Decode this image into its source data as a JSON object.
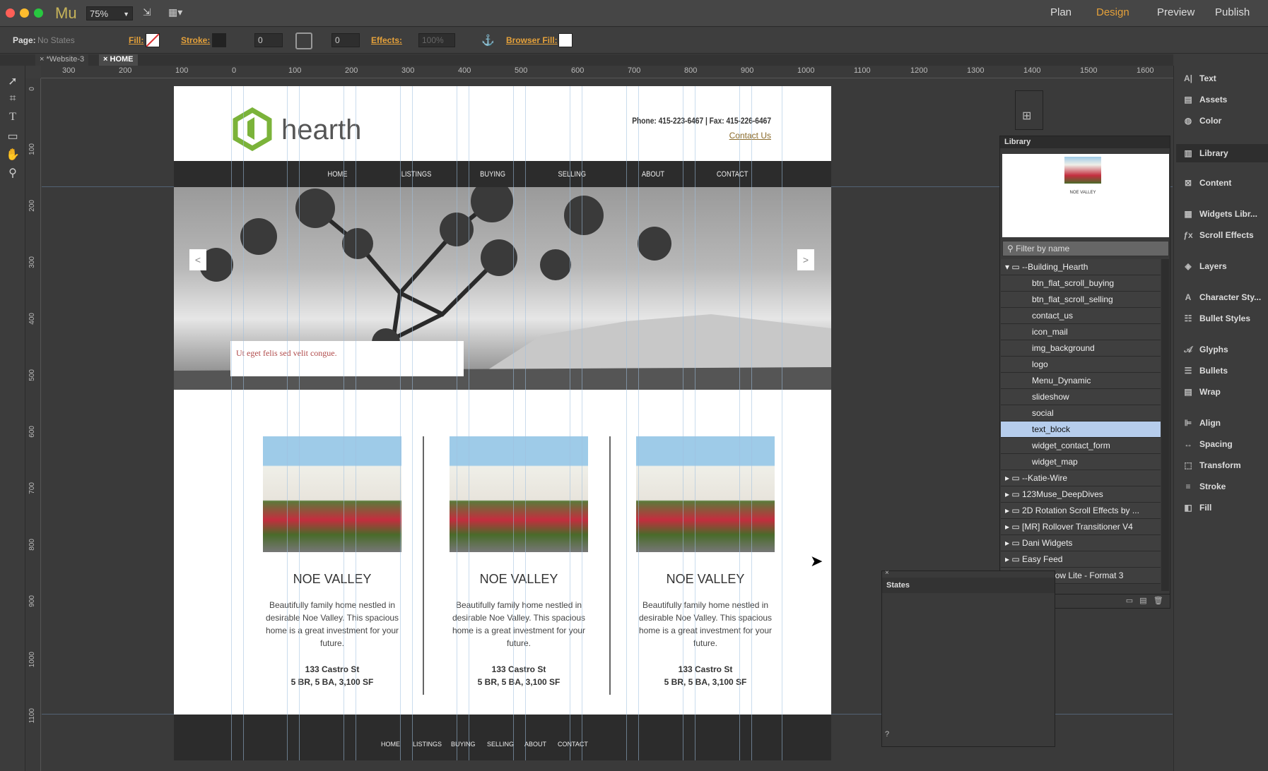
{
  "app": {
    "name": "Mu",
    "zoom": "75%",
    "modes": [
      "Plan",
      "Design",
      "Preview",
      "Publish"
    ],
    "active_mode": "Design"
  },
  "options": {
    "page_label": "Page:",
    "page_state": "No States",
    "fill_label": "Fill:",
    "stroke_label": "Stroke:",
    "stroke_value": "0",
    "corner_value": "0",
    "effects_label": "Effects:",
    "opacity": "100%",
    "browser_fill_label": "Browser Fill:"
  },
  "tabs": [
    {
      "label": "*Website-3"
    },
    {
      "label": "HOME"
    }
  ],
  "ruler": {
    "h": [
      "300",
      "200",
      "100",
      "0",
      "100",
      "200",
      "300",
      "400",
      "500",
      "600",
      "700",
      "800",
      "900",
      "1000",
      "1100",
      "1200",
      "1300",
      "1400",
      "1500",
      "1600"
    ],
    "v": [
      "0",
      "100",
      "200",
      "300",
      "400",
      "500",
      "600",
      "700",
      "800",
      "900",
      "1000",
      "1100"
    ]
  },
  "site": {
    "logo": "hearth",
    "phone": "Phone: 415-223-6467 | Fax: 415-226-6467",
    "contact": "Contact Us",
    "nav": [
      "HOME",
      "LISTINGS",
      "BUYING",
      "SELLING",
      "ABOUT",
      "CONTACT"
    ],
    "caption": "Ut eget felis sed velit congue.",
    "prev": "<",
    "next": ">",
    "cards": [
      {
        "title": "NOE VALLEY",
        "desc": "Beautifully family home nestled in desirable Noe Valley. This spacious home is a great investment for your future.",
        "address": "133 Castro St",
        "specs": "5 BR, 5 BA, 3,100 SF"
      },
      {
        "title": "NOE VALLEY",
        "desc": "Beautifully family home nestled in desirable Noe Valley. This spacious home is a great investment for your future.",
        "address": "133 Castro St",
        "specs": "5 BR, 5 BA, 3,100 SF"
      },
      {
        "title": "NOE VALLEY",
        "desc": "Beautifully family home nestled in desirable Noe Valley. This spacious home is a great investment for your future.",
        "address": "133 Castro St",
        "specs": "5 BR, 5 BA, 3,100 SF"
      }
    ],
    "footer_nav": [
      "HOME",
      "LISTINGS",
      "BUYING",
      "SELLING",
      "ABOUT",
      "CONTACT"
    ]
  },
  "right_panel": [
    {
      "label": "Text",
      "icon": "text-icon"
    },
    {
      "label": "Assets",
      "icon": "assets-icon"
    },
    {
      "label": "Color",
      "icon": "color-icon"
    },
    {
      "label": "Library",
      "icon": "library-icon"
    },
    {
      "label": "Content",
      "icon": "content-icon"
    },
    {
      "label": "Widgets Libr...",
      "icon": "widgets-icon"
    },
    {
      "label": "Scroll Effects",
      "icon": "scroll-effects-icon"
    },
    {
      "label": "Layers",
      "icon": "layers-icon"
    },
    {
      "label": "Character Sty...",
      "icon": "character-styles-icon"
    },
    {
      "label": "Bullet Styles",
      "icon": "bullet-styles-icon"
    },
    {
      "label": "Glyphs",
      "icon": "glyphs-icon"
    },
    {
      "label": "Bullets",
      "icon": "bullets-icon"
    },
    {
      "label": "Wrap",
      "icon": "wrap-icon"
    },
    {
      "label": "Align",
      "icon": "align-icon"
    },
    {
      "label": "Spacing",
      "icon": "spacing-icon"
    },
    {
      "label": "Transform",
      "icon": "transform-icon"
    },
    {
      "label": "Stroke",
      "icon": "stroke-icon"
    },
    {
      "label": "Fill",
      "icon": "fill-icon"
    }
  ],
  "library": {
    "title": "Library",
    "preview_caption": "NOE VALLEY",
    "filter_placeholder": "Filter by name",
    "rows": [
      {
        "label": "--Building_Hearth",
        "folder": true,
        "expanded": true
      },
      {
        "label": "btn_flat_scroll_buying"
      },
      {
        "label": "btn_flat_scroll_selling"
      },
      {
        "label": "contact_us"
      },
      {
        "label": "icon_mail"
      },
      {
        "label": "img_background"
      },
      {
        "label": "logo"
      },
      {
        "label": "Menu_Dynamic"
      },
      {
        "label": "slideshow"
      },
      {
        "label": "social"
      },
      {
        "label": "text_block",
        "selected": true
      },
      {
        "label": "widget_contact_form"
      },
      {
        "label": "widget_map"
      },
      {
        "label": "--Katie-Wire",
        "folder": true
      },
      {
        "label": "123Muse_DeepDives",
        "folder": true
      },
      {
        "label": "2D Rotation Scroll Effects by ...",
        "folder": true
      },
      {
        "label": "[MR] Rollover Transitioner V4",
        "folder": true
      },
      {
        "label": "Dani Widgets",
        "folder": true
      },
      {
        "label": "Easy Feed",
        "folder": true
      },
      {
        "label": "Image Flow Lite - Format 3",
        "folder": true
      }
    ]
  },
  "states": {
    "title": "States"
  }
}
